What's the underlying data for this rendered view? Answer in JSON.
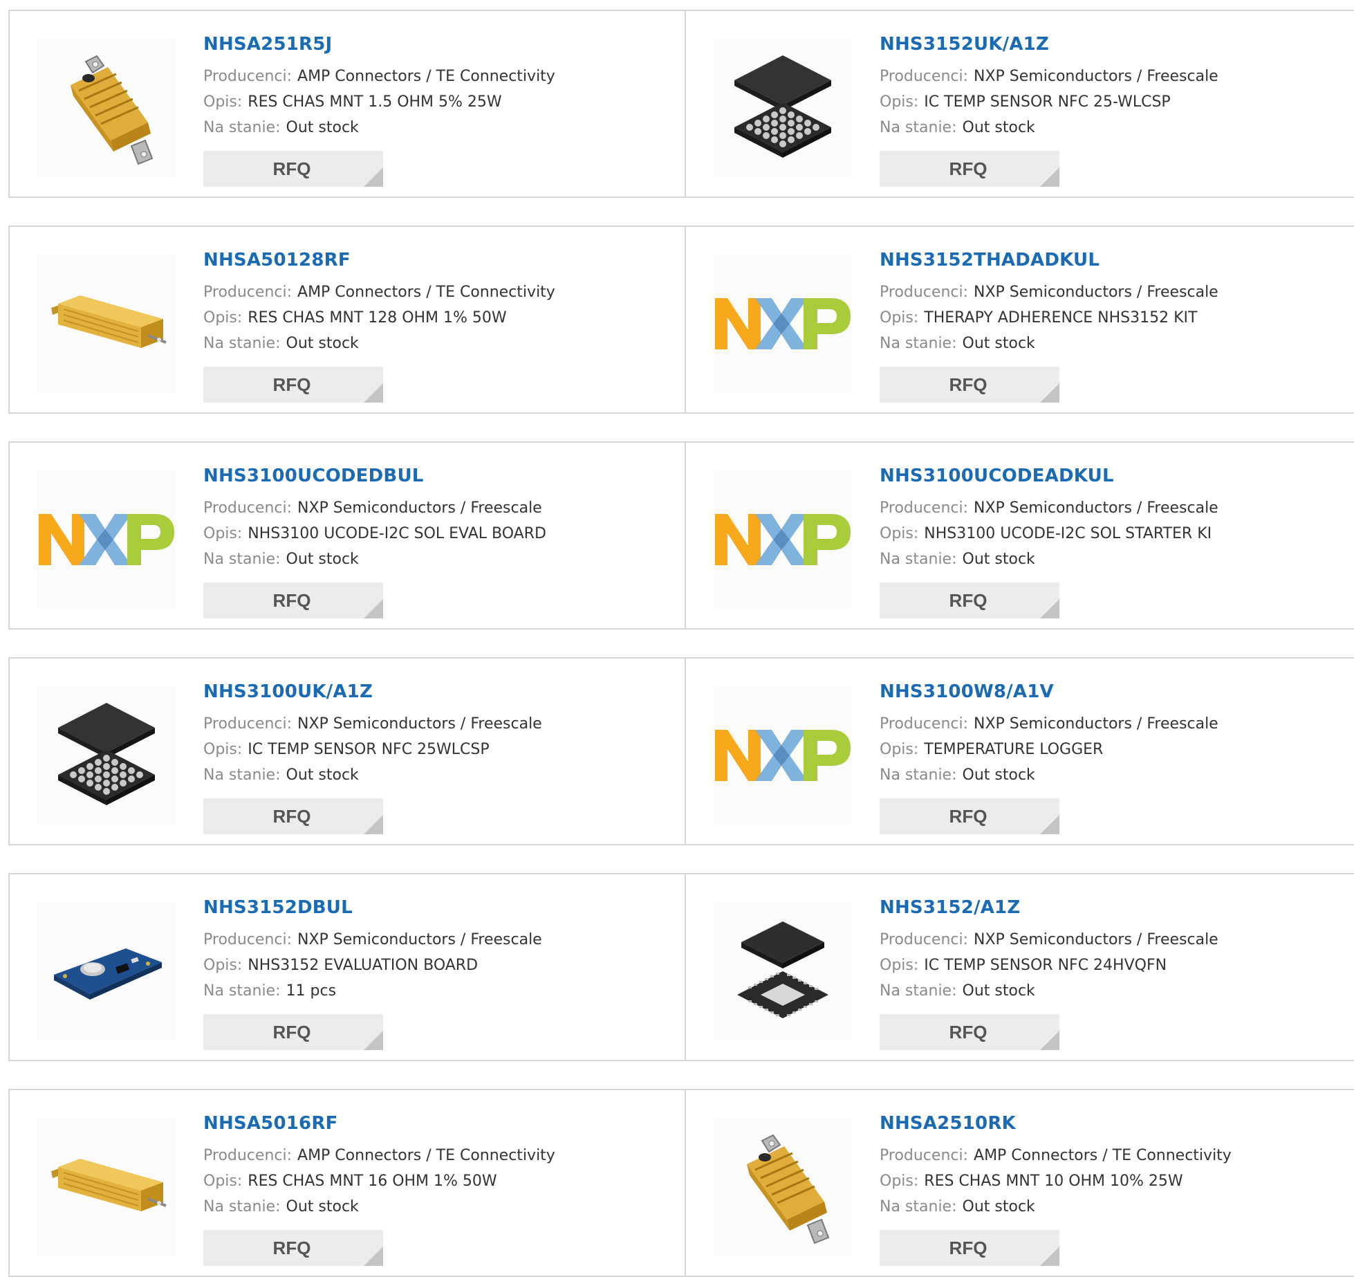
{
  "labels": {
    "manufacturer": "Producenci:",
    "description": "Opis:",
    "stock": "Na stanie:",
    "rfq": "RFQ"
  },
  "products": [
    {
      "part": "NHSA251R5J",
      "manufacturer": "AMP Connectors / TE Connectivity",
      "description": "RES CHAS MNT 1.5 OHM 5% 25W",
      "stock": "Out stock",
      "image": "resistor-upright"
    },
    {
      "part": "NHS3152UK/A1Z",
      "manufacturer": "NXP Semiconductors / Freescale",
      "description": "IC TEMP SENSOR NFC 25-WLCSP",
      "stock": "Out stock",
      "image": "wlcsp-chip"
    },
    {
      "part": "NHSA50128RF",
      "manufacturer": "AMP Connectors / TE Connectivity",
      "description": "RES CHAS MNT 128 OHM 1% 50W",
      "stock": "Out stock",
      "image": "resistor-flat"
    },
    {
      "part": "NHS3152THADADKUL",
      "manufacturer": "NXP Semiconductors / Freescale",
      "description": "THERAPY ADHERENCE NHS3152 KIT",
      "stock": "Out stock",
      "image": "nxp-logo"
    },
    {
      "part": "NHS3100UCODEDBUL",
      "manufacturer": "NXP Semiconductors / Freescale",
      "description": "NHS3100 UCODE-I2C SOL EVAL BOARD",
      "stock": "Out stock",
      "image": "nxp-logo"
    },
    {
      "part": "NHS3100UCODEADKUL",
      "manufacturer": "NXP Semiconductors / Freescale",
      "description": "NHS3100 UCODE-I2C SOL STARTER KI",
      "stock": "Out stock",
      "image": "nxp-logo"
    },
    {
      "part": "NHS3100UK/A1Z",
      "manufacturer": "NXP Semiconductors / Freescale",
      "description": "IC TEMP SENSOR NFC 25WLCSP",
      "stock": "Out stock",
      "image": "wlcsp-chip"
    },
    {
      "part": "NHS3100W8/A1V",
      "manufacturer": "NXP Semiconductors / Freescale",
      "description": "TEMPERATURE LOGGER",
      "stock": "Out stock",
      "image": "nxp-logo"
    },
    {
      "part": "NHS3152DBUL",
      "manufacturer": "NXP Semiconductors / Freescale",
      "description": "NHS3152 EVALUATION BOARD",
      "stock": "11 pcs",
      "image": "eval-board"
    },
    {
      "part": "NHS3152/A1Z",
      "manufacturer": "NXP Semiconductors / Freescale",
      "description": "IC TEMP SENSOR NFC 24HVQFN",
      "stock": "Out stock",
      "image": "qfn-chip"
    },
    {
      "part": "NHSA5016RF",
      "manufacturer": "AMP Connectors / TE Connectivity",
      "description": "RES CHAS MNT 16 OHM 1% 50W",
      "stock": "Out stock",
      "image": "resistor-flat"
    },
    {
      "part": "NHSA2510RK",
      "manufacturer": "AMP Connectors / TE Connectivity",
      "description": "RES CHAS MNT 10 OHM 10% 25W",
      "stock": "Out stock",
      "image": "resistor-upright"
    }
  ]
}
